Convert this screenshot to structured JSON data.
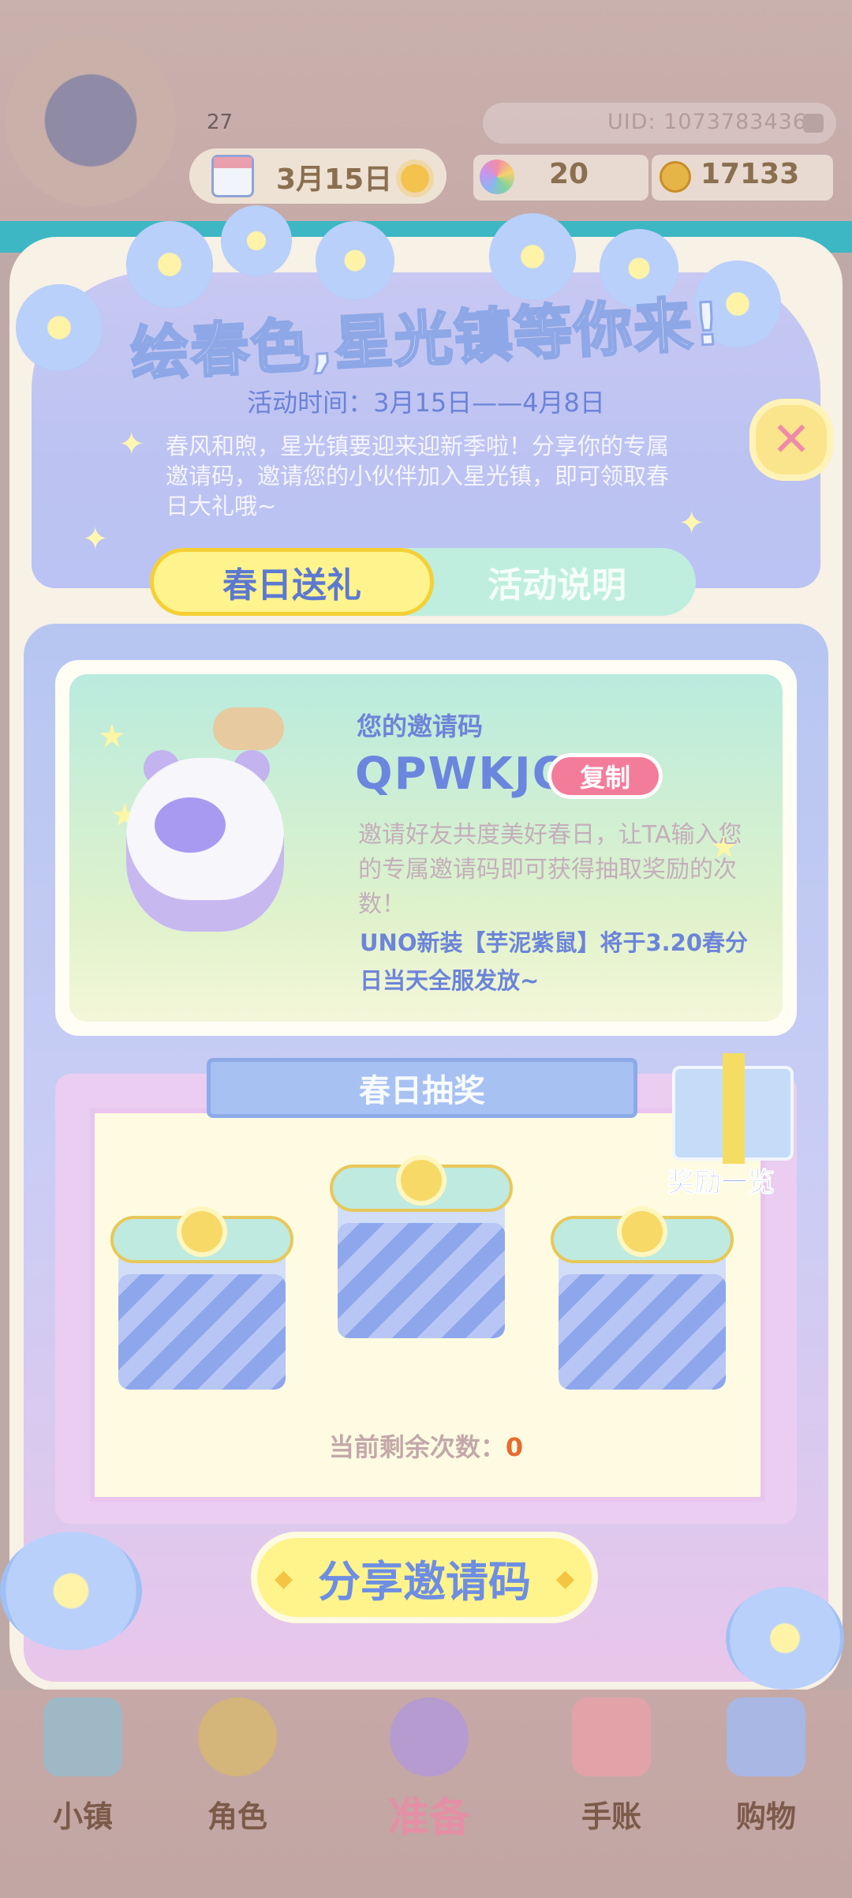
{
  "hud": {
    "level": "27",
    "uid": "UID: 1073783436",
    "date": "3月15日",
    "gems": "20",
    "coins": "17133"
  },
  "event": {
    "title": "绘春色,星光镇等你来!",
    "time": "活动时间：3月15日——4月8日",
    "intro": "春风和煦，星光镇要迎来迎新季啦！分享你的专属邀请码，邀请您的小伙伴加入星光镇，即可领取春日大礼哦~"
  },
  "tabs": {
    "active": "春日送礼",
    "inactive": "活动说明"
  },
  "invite": {
    "label": "您的邀请码",
    "code": "QPWKJQ",
    "copy": "复制",
    "desc": "邀请好友共度美好春日，让TA输入您的专属邀请码即可获得抽取奖励的次数！",
    "note": "UNO新装【芋泥紫鼠】将于3.20春分日当天全服发放~"
  },
  "lottery": {
    "title": "春日抽奖",
    "rewards_label": "奖励一览",
    "remaining_label": "当前剩余次数：",
    "remaining_value": "0"
  },
  "share": {
    "label": "分享邀请码"
  },
  "nav": {
    "town": "小镇",
    "character": "角色",
    "prepare": "准备",
    "journal": "手账",
    "shopping": "购物"
  },
  "colors": {
    "accent": "#6a86de",
    "yellow": "#fff38d",
    "pink": "#f47c9b",
    "count": "#e86b2d"
  },
  "icons": [
    "calendar-icon",
    "sun-icon",
    "gem-icon",
    "coin-icon",
    "close-icon",
    "gift-icon",
    "map-icon",
    "character-icon",
    "journal-icon",
    "bag-icon"
  ]
}
